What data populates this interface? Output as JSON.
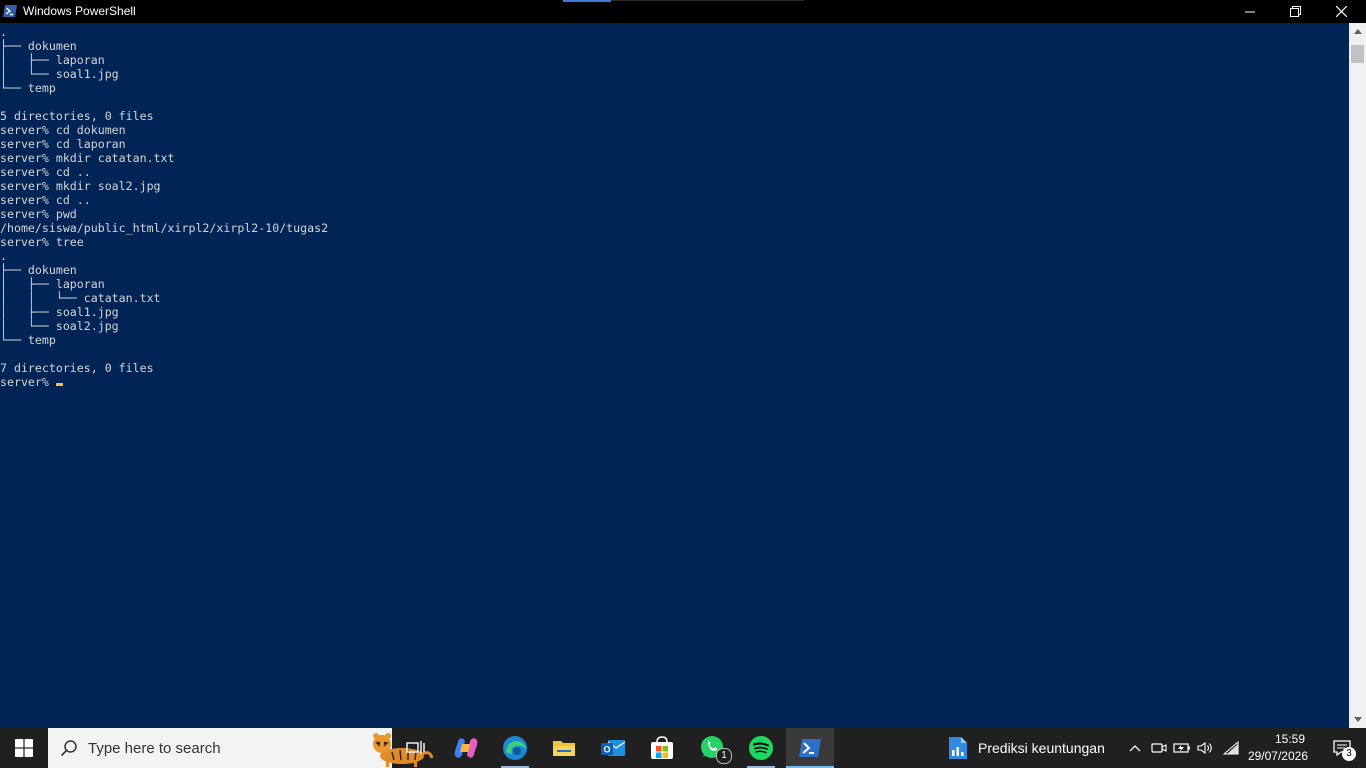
{
  "window": {
    "title": "Windows PowerShell"
  },
  "console": {
    "lines": [
      ".",
      "├── dokumen",
      "│   ├── laporan",
      "│   └── soal1.jpg",
      "└── temp",
      "",
      "5 directories, 0 files",
      "server% cd dokumen",
      "server% cd laporan",
      "server% mkdir catatan.txt",
      "server% cd ..",
      "server% mkdir soal2.jpg",
      "server% cd ..",
      "server% pwd",
      "/home/siswa/public_html/xirpl2/xirpl2-10/tugas2",
      "server% tree",
      ".",
      "├── dokumen",
      "│   ├── laporan",
      "│   │   └── catatan.txt",
      "│   ├── soal1.jpg",
      "│   └── soal2.jpg",
      "└── temp",
      "",
      "7 directories, 0 files",
      "server% "
    ],
    "text_color": "#d6d6d6",
    "background": "#012456"
  },
  "taskbar": {
    "search_placeholder": "Type here to search",
    "whatsapp_badge": "1",
    "widget_text": "Prediksi keuntungan",
    "time": "15:59",
    "date": "29/07/2026",
    "notification_count": "3",
    "apps": [
      "task-view",
      "copilot",
      "edge",
      "file-explorer",
      "outlook",
      "microsoft-store",
      "whatsapp",
      "spotify",
      "powershell"
    ]
  }
}
